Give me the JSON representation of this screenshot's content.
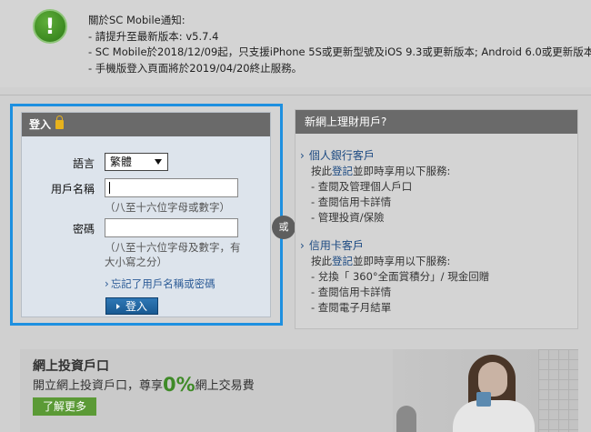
{
  "notice": {
    "icon": "exclamation-icon",
    "icon_glyph": "!",
    "title": "關於SC Mobile通知:",
    "lines": [
      "- 請提升至最新版本: v5.7.4",
      "- SC Mobile於2018/12/09起，只支援iPhone 5S或更新型號及iOS 9.3或更新版本; Android 6.0或更新版本",
      "- 手機版登入頁面將於2019/04/20終止服務。"
    ]
  },
  "login": {
    "title": "登入",
    "language_label": "語言",
    "language_value": "繁體",
    "username_label": "用戶名稱",
    "username_hint": "（八至十六位字母或數字）",
    "password_label": "密碼",
    "password_hint": "（八至十六位字母及數字，有大小寫之分）",
    "forgot_link": "忘記了用戶名稱或密碼",
    "submit": "登入"
  },
  "or_label": "或",
  "new_user": {
    "title": "新網上理財用戶?",
    "sections": [
      {
        "title": "個人銀行客戶",
        "intro_prefix": "按此",
        "intro_link": "登記",
        "intro_suffix": "並即時享用以下服務:",
        "items": [
          "- 查閱及管理個人戶口",
          "- 查閱信用卡詳情",
          "- 管理投資/保險"
        ]
      },
      {
        "title": "信用卡客戶",
        "intro_prefix": "按此",
        "intro_link": "登記",
        "intro_suffix": "並即時享用以下服務:",
        "items": [
          "- 兌換「 360°全面賞積分」/ 現金回贈",
          "- 查閱信用卡詳情",
          "- 查閱電子月結單"
        ]
      }
    ]
  },
  "banner": {
    "title": "網上投資戶口",
    "sub_prefix": "開立網上投資戶口，尊享",
    "sub_highlight": "0%",
    "sub_suffix": "網上交易費",
    "more_button": "了解更多"
  },
  "colors": {
    "frame_highlight": "#1e90e0",
    "header_gray": "#6a6a6a",
    "link_blue": "#1c4a82",
    "accent_green": "#3f8a28"
  }
}
